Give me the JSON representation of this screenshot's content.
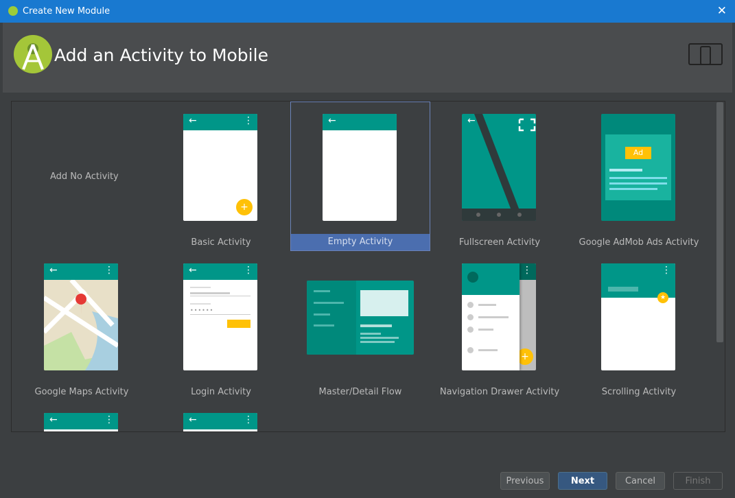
{
  "window": {
    "title": "Create New Module"
  },
  "header": {
    "title": "Add an Activity to Mobile"
  },
  "gallery": {
    "no_activity": "Add No Activity",
    "tiles": [
      "Basic Activity",
      "Empty Activity",
      "Fullscreen Activity",
      "Google AdMob Ads Activity",
      "Google Maps Activity",
      "Login Activity",
      "Master/Detail Flow",
      "Navigation Drawer Activity",
      "Scrolling Activity"
    ],
    "selected": "Empty Activity",
    "ad_label": "Ad"
  },
  "buttons": {
    "previous": "Previous",
    "next": "Next",
    "cancel": "Cancel",
    "finish": "Finish"
  },
  "colors": {
    "teal": "#009688",
    "accent": "#ffc107",
    "selection": "#4b6eaf",
    "titlebar": "#1979d0"
  }
}
